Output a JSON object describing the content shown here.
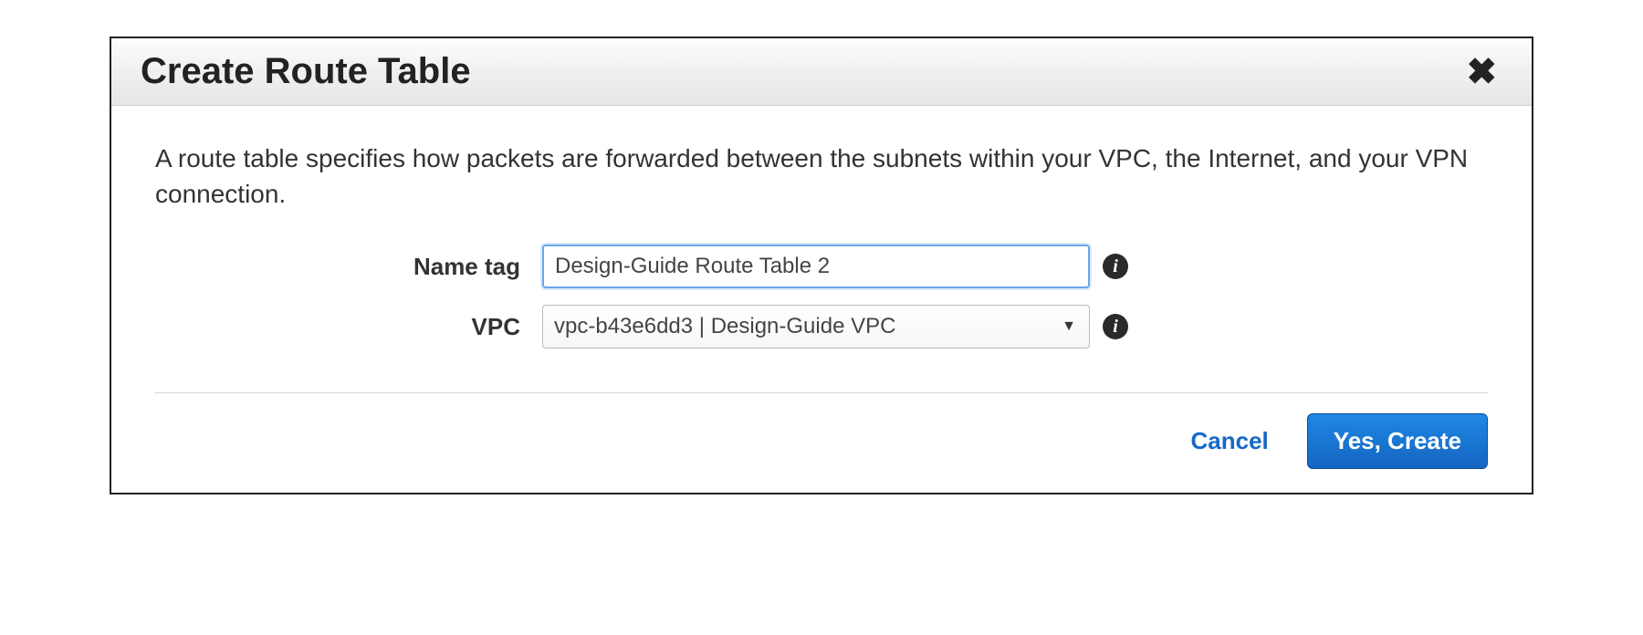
{
  "dialog": {
    "title": "Create Route Table",
    "close_glyph": "✖",
    "description": "A route table specifies how packets are forwarded between the subnets within your VPC, the Internet, and your VPN connection."
  },
  "form": {
    "name_tag": {
      "label": "Name tag",
      "value": "Design-Guide Route Table 2"
    },
    "vpc": {
      "label": "VPC",
      "selected": "vpc-b43e6dd3 | Design-Guide VPC"
    }
  },
  "info_glyph": "i",
  "caret_glyph": "▼",
  "footer": {
    "cancel": "Cancel",
    "confirm": "Yes, Create"
  }
}
